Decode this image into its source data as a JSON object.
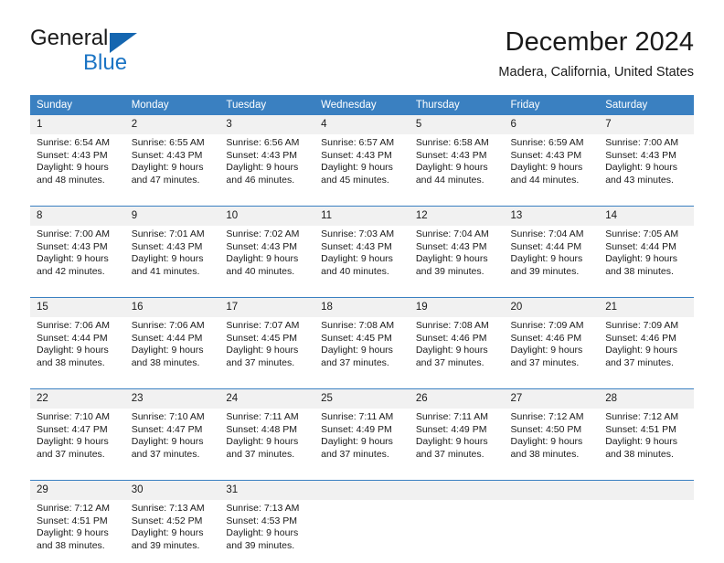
{
  "brand": {
    "name_part1": "General",
    "name_part2": "Blue",
    "triangle_icon": "triangle-icon",
    "accent_color": "#1b74c4"
  },
  "header": {
    "title": "December 2024",
    "location": "Madera, California, United States"
  },
  "theme": {
    "header_bg": "#3a80c1",
    "daynum_bg": "#f1f1f1",
    "text": "#1a1a1a"
  },
  "calendar": {
    "weekday_headers": [
      "Sunday",
      "Monday",
      "Tuesday",
      "Wednesday",
      "Thursday",
      "Friday",
      "Saturday"
    ],
    "weeks": [
      [
        {
          "day": "1",
          "sunrise": "Sunrise: 6:54 AM",
          "sunset": "Sunset: 4:43 PM",
          "daylight1": "Daylight: 9 hours",
          "daylight2": "and 48 minutes."
        },
        {
          "day": "2",
          "sunrise": "Sunrise: 6:55 AM",
          "sunset": "Sunset: 4:43 PM",
          "daylight1": "Daylight: 9 hours",
          "daylight2": "and 47 minutes."
        },
        {
          "day": "3",
          "sunrise": "Sunrise: 6:56 AM",
          "sunset": "Sunset: 4:43 PM",
          "daylight1": "Daylight: 9 hours",
          "daylight2": "and 46 minutes."
        },
        {
          "day": "4",
          "sunrise": "Sunrise: 6:57 AM",
          "sunset": "Sunset: 4:43 PM",
          "daylight1": "Daylight: 9 hours",
          "daylight2": "and 45 minutes."
        },
        {
          "day": "5",
          "sunrise": "Sunrise: 6:58 AM",
          "sunset": "Sunset: 4:43 PM",
          "daylight1": "Daylight: 9 hours",
          "daylight2": "and 44 minutes."
        },
        {
          "day": "6",
          "sunrise": "Sunrise: 6:59 AM",
          "sunset": "Sunset: 4:43 PM",
          "daylight1": "Daylight: 9 hours",
          "daylight2": "and 44 minutes."
        },
        {
          "day": "7",
          "sunrise": "Sunrise: 7:00 AM",
          "sunset": "Sunset: 4:43 PM",
          "daylight1": "Daylight: 9 hours",
          "daylight2": "and 43 minutes."
        }
      ],
      [
        {
          "day": "8",
          "sunrise": "Sunrise: 7:00 AM",
          "sunset": "Sunset: 4:43 PM",
          "daylight1": "Daylight: 9 hours",
          "daylight2": "and 42 minutes."
        },
        {
          "day": "9",
          "sunrise": "Sunrise: 7:01 AM",
          "sunset": "Sunset: 4:43 PM",
          "daylight1": "Daylight: 9 hours",
          "daylight2": "and 41 minutes."
        },
        {
          "day": "10",
          "sunrise": "Sunrise: 7:02 AM",
          "sunset": "Sunset: 4:43 PM",
          "daylight1": "Daylight: 9 hours",
          "daylight2": "and 40 minutes."
        },
        {
          "day": "11",
          "sunrise": "Sunrise: 7:03 AM",
          "sunset": "Sunset: 4:43 PM",
          "daylight1": "Daylight: 9 hours",
          "daylight2": "and 40 minutes."
        },
        {
          "day": "12",
          "sunrise": "Sunrise: 7:04 AM",
          "sunset": "Sunset: 4:43 PM",
          "daylight1": "Daylight: 9 hours",
          "daylight2": "and 39 minutes."
        },
        {
          "day": "13",
          "sunrise": "Sunrise: 7:04 AM",
          "sunset": "Sunset: 4:44 PM",
          "daylight1": "Daylight: 9 hours",
          "daylight2": "and 39 minutes."
        },
        {
          "day": "14",
          "sunrise": "Sunrise: 7:05 AM",
          "sunset": "Sunset: 4:44 PM",
          "daylight1": "Daylight: 9 hours",
          "daylight2": "and 38 minutes."
        }
      ],
      [
        {
          "day": "15",
          "sunrise": "Sunrise: 7:06 AM",
          "sunset": "Sunset: 4:44 PM",
          "daylight1": "Daylight: 9 hours",
          "daylight2": "and 38 minutes."
        },
        {
          "day": "16",
          "sunrise": "Sunrise: 7:06 AM",
          "sunset": "Sunset: 4:44 PM",
          "daylight1": "Daylight: 9 hours",
          "daylight2": "and 38 minutes."
        },
        {
          "day": "17",
          "sunrise": "Sunrise: 7:07 AM",
          "sunset": "Sunset: 4:45 PM",
          "daylight1": "Daylight: 9 hours",
          "daylight2": "and 37 minutes."
        },
        {
          "day": "18",
          "sunrise": "Sunrise: 7:08 AM",
          "sunset": "Sunset: 4:45 PM",
          "daylight1": "Daylight: 9 hours",
          "daylight2": "and 37 minutes."
        },
        {
          "day": "19",
          "sunrise": "Sunrise: 7:08 AM",
          "sunset": "Sunset: 4:46 PM",
          "daylight1": "Daylight: 9 hours",
          "daylight2": "and 37 minutes."
        },
        {
          "day": "20",
          "sunrise": "Sunrise: 7:09 AM",
          "sunset": "Sunset: 4:46 PM",
          "daylight1": "Daylight: 9 hours",
          "daylight2": "and 37 minutes."
        },
        {
          "day": "21",
          "sunrise": "Sunrise: 7:09 AM",
          "sunset": "Sunset: 4:46 PM",
          "daylight1": "Daylight: 9 hours",
          "daylight2": "and 37 minutes."
        }
      ],
      [
        {
          "day": "22",
          "sunrise": "Sunrise: 7:10 AM",
          "sunset": "Sunset: 4:47 PM",
          "daylight1": "Daylight: 9 hours",
          "daylight2": "and 37 minutes."
        },
        {
          "day": "23",
          "sunrise": "Sunrise: 7:10 AM",
          "sunset": "Sunset: 4:47 PM",
          "daylight1": "Daylight: 9 hours",
          "daylight2": "and 37 minutes."
        },
        {
          "day": "24",
          "sunrise": "Sunrise: 7:11 AM",
          "sunset": "Sunset: 4:48 PM",
          "daylight1": "Daylight: 9 hours",
          "daylight2": "and 37 minutes."
        },
        {
          "day": "25",
          "sunrise": "Sunrise: 7:11 AM",
          "sunset": "Sunset: 4:49 PM",
          "daylight1": "Daylight: 9 hours",
          "daylight2": "and 37 minutes."
        },
        {
          "day": "26",
          "sunrise": "Sunrise: 7:11 AM",
          "sunset": "Sunset: 4:49 PM",
          "daylight1": "Daylight: 9 hours",
          "daylight2": "and 37 minutes."
        },
        {
          "day": "27",
          "sunrise": "Sunrise: 7:12 AM",
          "sunset": "Sunset: 4:50 PM",
          "daylight1": "Daylight: 9 hours",
          "daylight2": "and 38 minutes."
        },
        {
          "day": "28",
          "sunrise": "Sunrise: 7:12 AM",
          "sunset": "Sunset: 4:51 PM",
          "daylight1": "Daylight: 9 hours",
          "daylight2": "and 38 minutes."
        }
      ],
      [
        {
          "day": "29",
          "sunrise": "Sunrise: 7:12 AM",
          "sunset": "Sunset: 4:51 PM",
          "daylight1": "Daylight: 9 hours",
          "daylight2": "and 38 minutes."
        },
        {
          "day": "30",
          "sunrise": "Sunrise: 7:13 AM",
          "sunset": "Sunset: 4:52 PM",
          "daylight1": "Daylight: 9 hours",
          "daylight2": "and 39 minutes."
        },
        {
          "day": "31",
          "sunrise": "Sunrise: 7:13 AM",
          "sunset": "Sunset: 4:53 PM",
          "daylight1": "Daylight: 9 hours",
          "daylight2": "and 39 minutes."
        },
        {
          "day": "",
          "sunrise": "",
          "sunset": "",
          "daylight1": "",
          "daylight2": ""
        },
        {
          "day": "",
          "sunrise": "",
          "sunset": "",
          "daylight1": "",
          "daylight2": ""
        },
        {
          "day": "",
          "sunrise": "",
          "sunset": "",
          "daylight1": "",
          "daylight2": ""
        },
        {
          "day": "",
          "sunrise": "",
          "sunset": "",
          "daylight1": "",
          "daylight2": ""
        }
      ]
    ]
  }
}
